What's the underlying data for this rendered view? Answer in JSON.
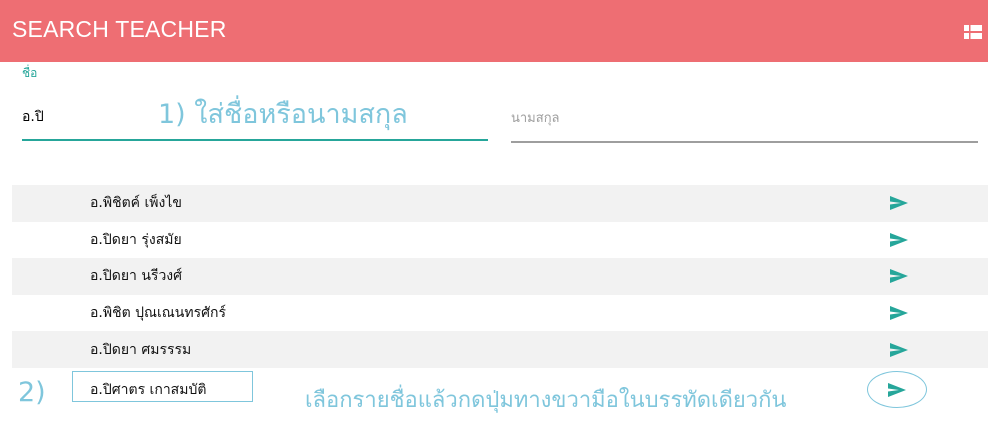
{
  "header": {
    "title": "SEARCH TEACHER",
    "menu_icon": "view-module-icon"
  },
  "search": {
    "name_label": "ชื่อ",
    "name_value": "อ.ปิ",
    "surname_placeholder": "นามสกุล"
  },
  "annotations": {
    "step1": "1) ใส่ชื่อหรือนามสกุล",
    "step2": "2)",
    "step2_text": "เลือกรายชื่อแล้วกดปุ่มทางขวามือในบรรทัดเดียวกัน"
  },
  "results": [
    {
      "name": "อ.พิชิตค์ เพ็งไข"
    },
    {
      "name": "อ.ปิดยา รุ่งสมัย"
    },
    {
      "name": "อ.ปิดยา นรีวงศ์"
    },
    {
      "name": "อ.พิชิต ปุณเณนทรศักร์"
    },
    {
      "name": "อ.ปิดยา ศมรรรม"
    },
    {
      "name": "อ.ปิศาตร เกาสมบัติ"
    }
  ],
  "colors": {
    "header": "#ee6e73",
    "accent": "#26a69a",
    "annotation": "#7fc6dc"
  }
}
